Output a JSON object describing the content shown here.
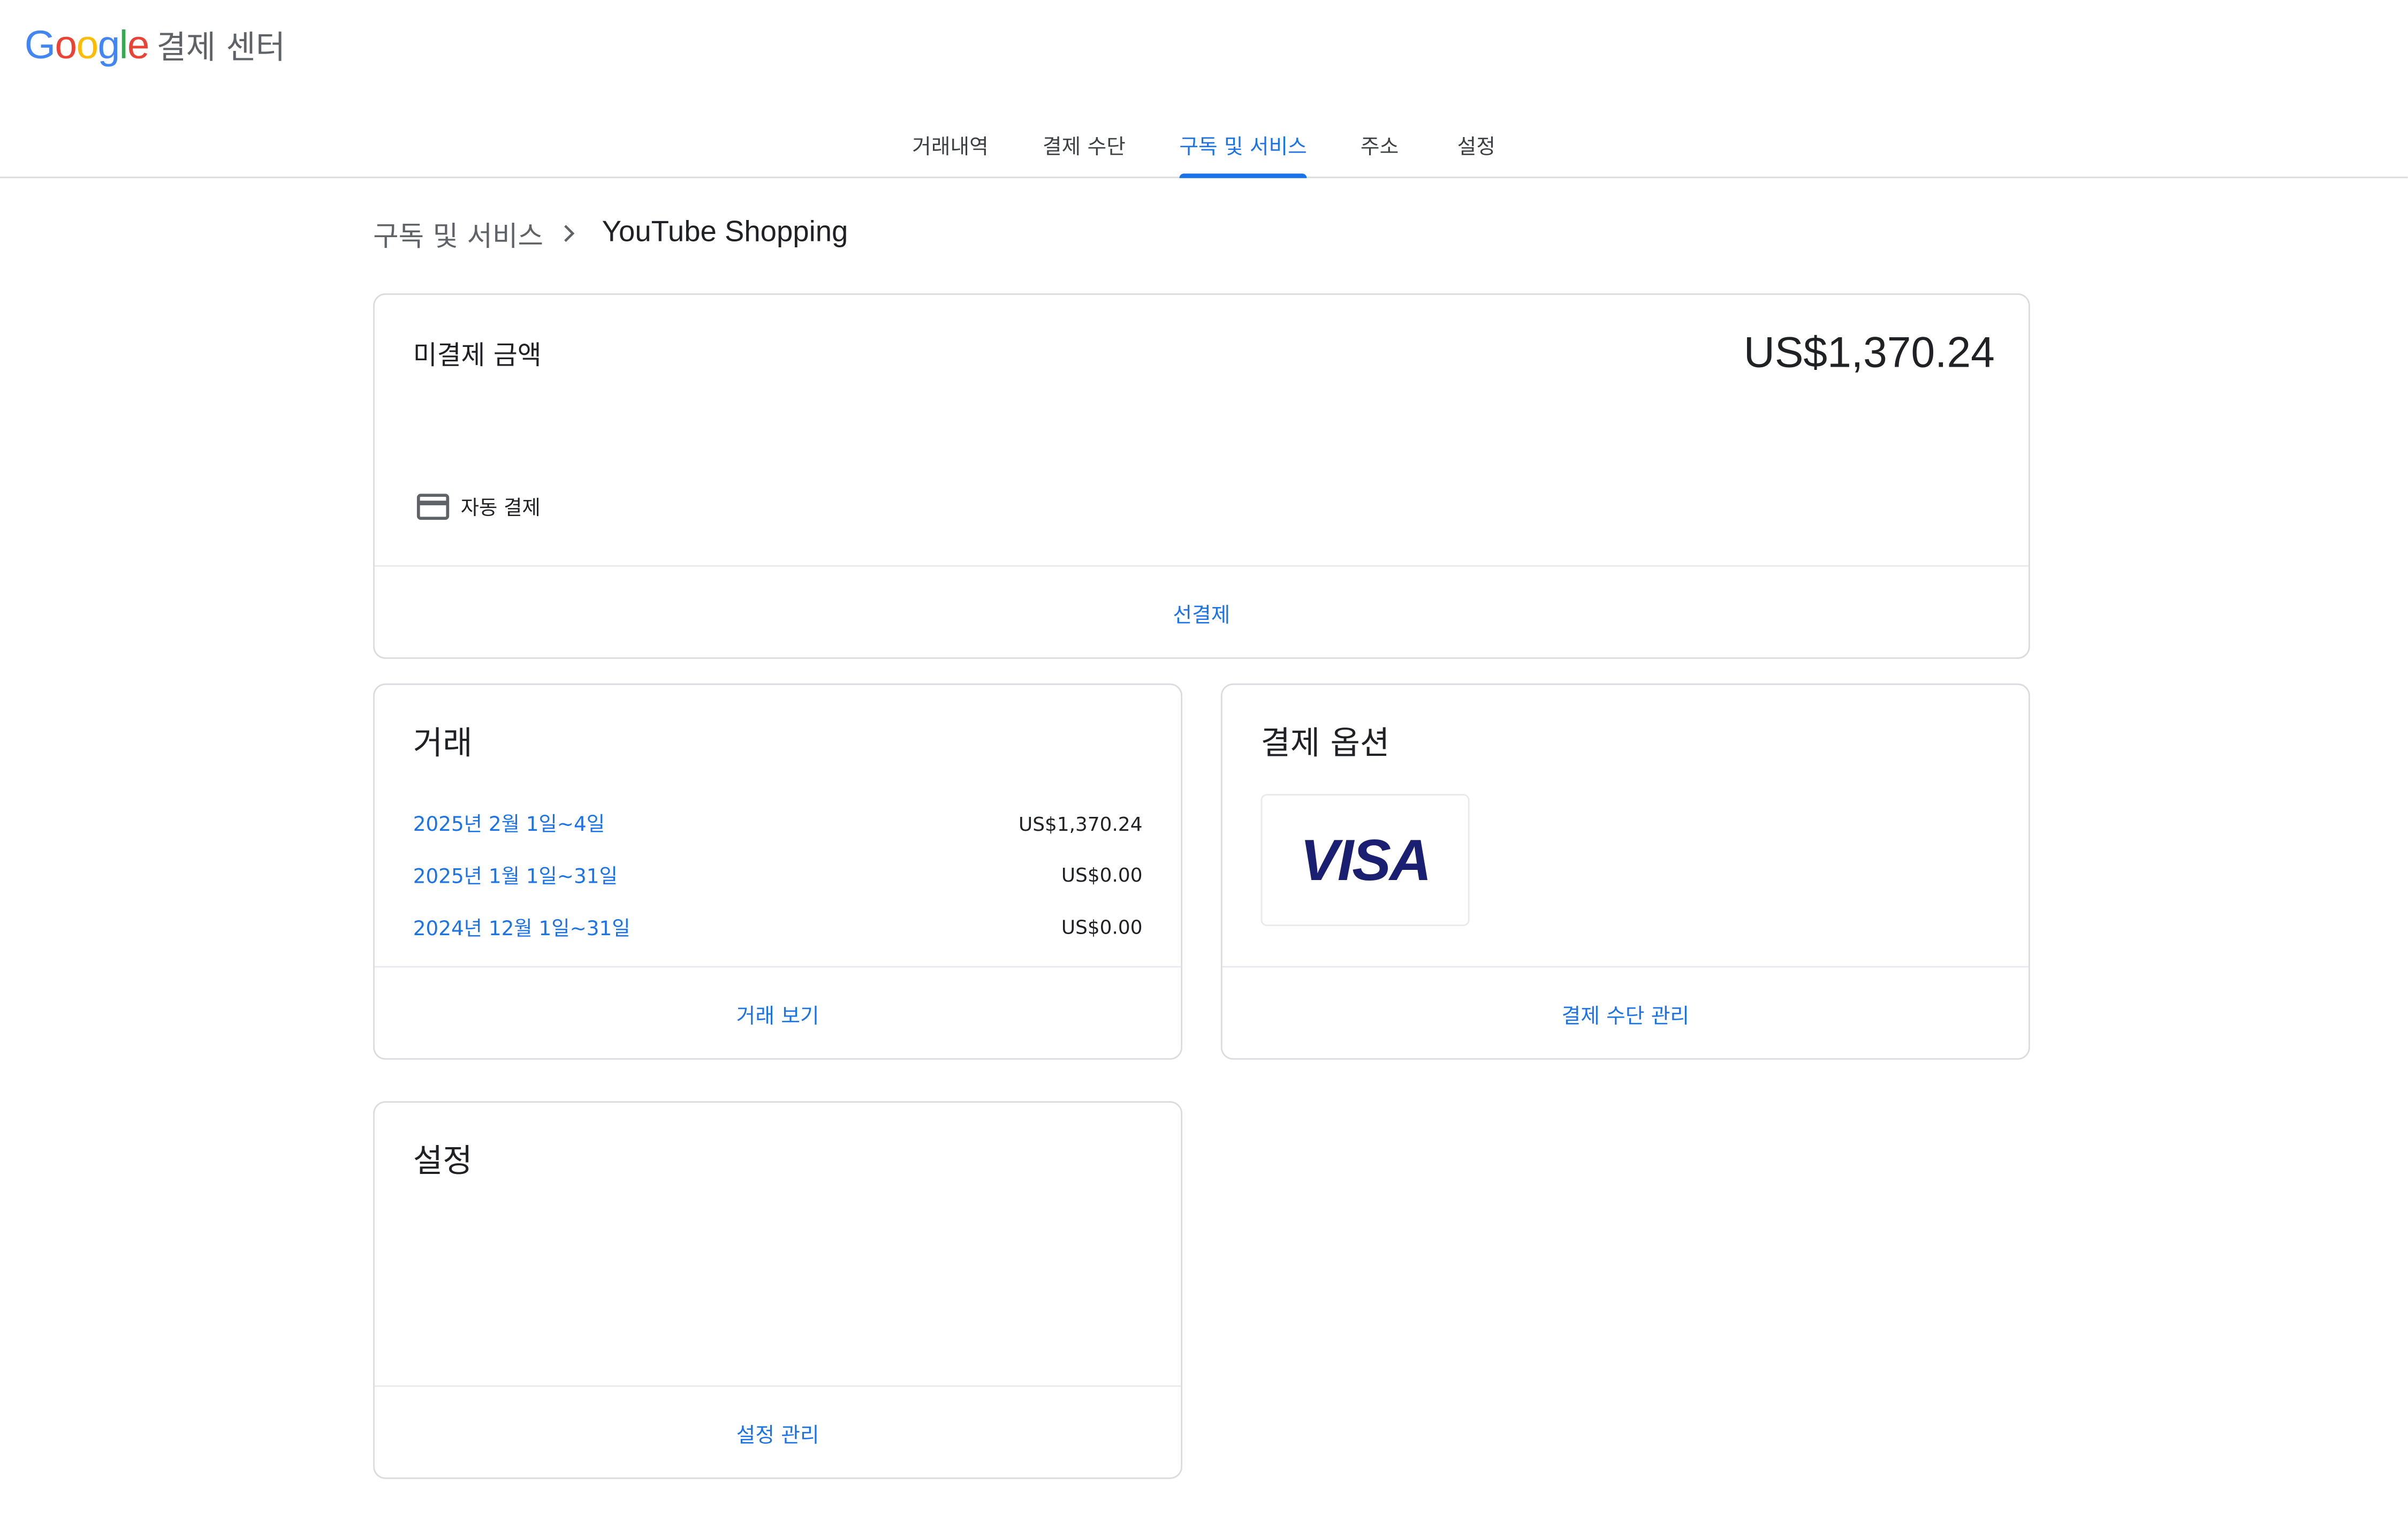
{
  "header": {
    "logo": [
      "G",
      "o",
      "o",
      "g",
      "l",
      "e"
    ],
    "title": "결제 센터"
  },
  "tabs": [
    {
      "label": "거래내역",
      "active": false
    },
    {
      "label": "결제 수단",
      "active": false
    },
    {
      "label": "구독 및 서비스",
      "active": true
    },
    {
      "label": "주소",
      "active": false
    },
    {
      "label": "설정",
      "active": false
    }
  ],
  "breadcrumb": {
    "parent": "구독 및 서비스",
    "current": "YouTube Shopping"
  },
  "balance_card": {
    "label": "미결제 금액",
    "amount": "US$1,370.24",
    "autopay_label": "자동 결제",
    "action": "선결제"
  },
  "transactions_card": {
    "title": "거래",
    "rows": [
      {
        "period": "2025년 2월 1일~4일",
        "amount": "US$1,370.24"
      },
      {
        "period": "2025년 1월 1일~31일",
        "amount": "US$0.00"
      },
      {
        "period": "2024년 12월 1일~31일",
        "amount": "US$0.00"
      }
    ],
    "action": "거래 보기"
  },
  "payment_card": {
    "title": "결제 옵션",
    "card_brand": "VISA",
    "action": "결제 수단 관리"
  },
  "settings_card": {
    "title": "설정",
    "action": "설정 관리"
  },
  "colors": {
    "accent": "#1a73e8",
    "visa": "#1a1f71",
    "border": "#dadce0"
  }
}
